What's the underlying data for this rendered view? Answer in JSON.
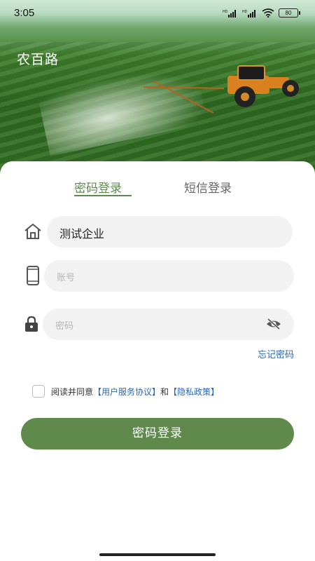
{
  "status_bar": {
    "time": "3:05",
    "battery": "80"
  },
  "header": {
    "app_name": "农百路"
  },
  "tabs": [
    {
      "label": "密码登录",
      "active": true
    },
    {
      "label": "短信登录",
      "active": false
    }
  ],
  "form": {
    "company": {
      "value": "测试企业",
      "icon": "home-icon"
    },
    "account": {
      "placeholder": "账号",
      "icon": "phone-icon"
    },
    "password": {
      "placeholder": "密码",
      "icon": "lock-icon",
      "toggle_icon": "eye-off-icon"
    },
    "forgot_label": "忘记密码"
  },
  "agreement": {
    "prefix": "阅读并同意",
    "user_agreement": "【用户服务协议】",
    "and": "和",
    "privacy_policy": "【隐私政策】",
    "checked": false
  },
  "submit_label": "密码登录",
  "colors": {
    "primary_green": "#5f8a4c",
    "link_blue": "#2a67b5",
    "field_bg": "#f2f2f2"
  }
}
